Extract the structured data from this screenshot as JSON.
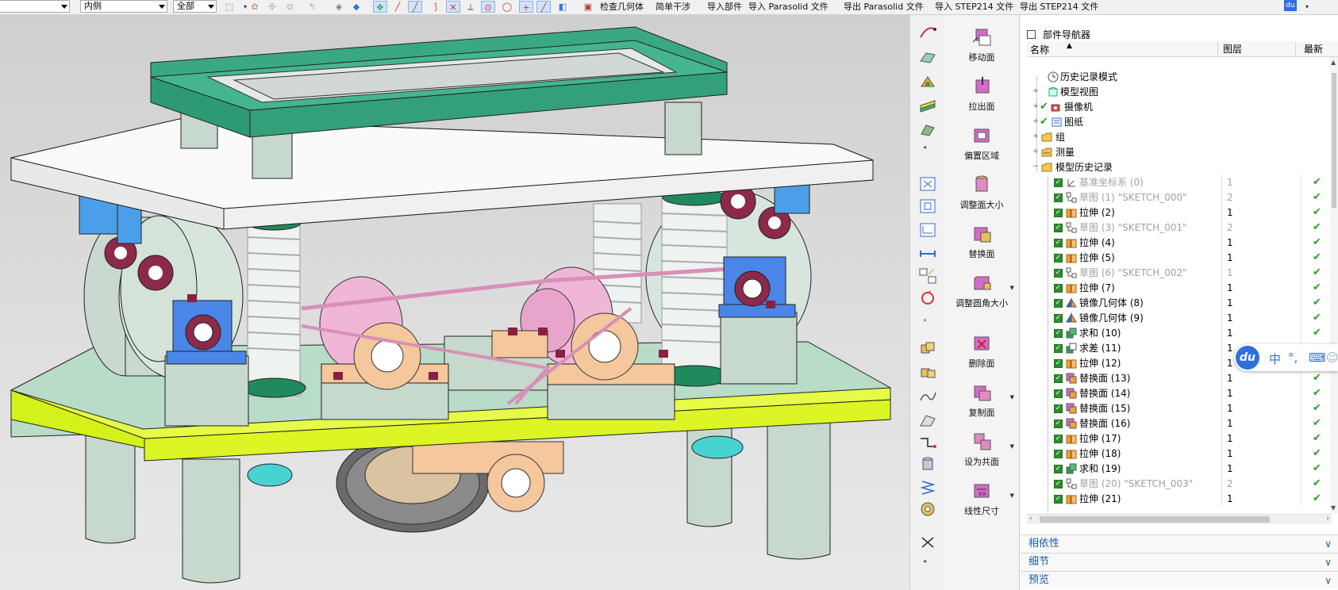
{
  "toolbar": {
    "filter_value": "内侧",
    "scope_value": "全部",
    "actions": [
      "检查几何体",
      "简单干涉",
      "导入部件",
      "导入 Parasolid 文件",
      "导出 Parasolid 文件",
      "导入 STEP214 文件",
      "导出 STEP214 文件"
    ],
    "accent": "#cfe3fb"
  },
  "commands": [
    {
      "label": "移动面",
      "icon": "move-face-icon"
    },
    {
      "label": "拉出面",
      "icon": "pull-face-icon"
    },
    {
      "label": "偏置区域",
      "icon": "offset-region-icon"
    },
    {
      "label": "调整面大小",
      "icon": "resize-face-icon"
    },
    {
      "label": "替换面",
      "icon": "replace-face-icon"
    },
    {
      "label": "调整圆角大小",
      "icon": "resize-blend-icon"
    },
    {
      "label": "删除面",
      "icon": "delete-face-icon"
    },
    {
      "label": "复制面",
      "icon": "copy-face-icon"
    },
    {
      "label": "设为共面",
      "icon": "make-coplanar-icon"
    },
    {
      "label": "线性尺寸",
      "icon": "linear-dimension-icon"
    }
  ],
  "navigator": {
    "title": "部件导航器",
    "columns": {
      "name": "名称",
      "layer": "图层",
      "latest": "最新"
    },
    "top_nodes": [
      {
        "label": "历史记录模式"
      },
      {
        "label": "模型视图"
      },
      {
        "label": "摄像机"
      },
      {
        "label": "图纸"
      },
      {
        "label": "组"
      },
      {
        "label": "测量"
      },
      {
        "label": "模型历史记录"
      }
    ],
    "features": [
      {
        "name": "基准坐标系 (0)",
        "layer": "1"
      },
      {
        "name": "草图 (1) \"SKETCH_000\"",
        "layer": "2"
      },
      {
        "name": "拉伸 (2)",
        "layer": "1"
      },
      {
        "name": "草图 (3) \"SKETCH_001\"",
        "layer": "2"
      },
      {
        "name": "拉伸 (4)",
        "layer": "1"
      },
      {
        "name": "拉伸 (5)",
        "layer": "1"
      },
      {
        "name": "草图 (6) \"SKETCH_002\"",
        "layer": "1"
      },
      {
        "name": "拉伸 (7)",
        "layer": "1"
      },
      {
        "name": "镜像几何体 (8)",
        "layer": "1"
      },
      {
        "name": "镜像几何体 (9)",
        "layer": "1"
      },
      {
        "name": "求和 (10)",
        "layer": "1"
      },
      {
        "name": "求差 (11)",
        "layer": "1"
      },
      {
        "name": "拉伸 (12)",
        "layer": "1"
      },
      {
        "name": "替换面 (13)",
        "layer": "1"
      },
      {
        "name": "替换面 (14)",
        "layer": "1"
      },
      {
        "name": "替换面 (15)",
        "layer": "1"
      },
      {
        "name": "替换面 (16)",
        "layer": "1"
      },
      {
        "name": "拉伸 (17)",
        "layer": "1"
      },
      {
        "name": "拉伸 (18)",
        "layer": "1"
      },
      {
        "name": "求和 (19)",
        "layer": "1"
      },
      {
        "name": "草图 (20) \"SKETCH_003\"",
        "layer": "2"
      },
      {
        "name": "拉伸 (21)",
        "layer": "1"
      }
    ],
    "latest_mark": "✔",
    "sections": [
      "相依性",
      "细节",
      "预览"
    ]
  },
  "ime": {
    "logo": "du",
    "mode": "中",
    "punct": "°,"
  }
}
